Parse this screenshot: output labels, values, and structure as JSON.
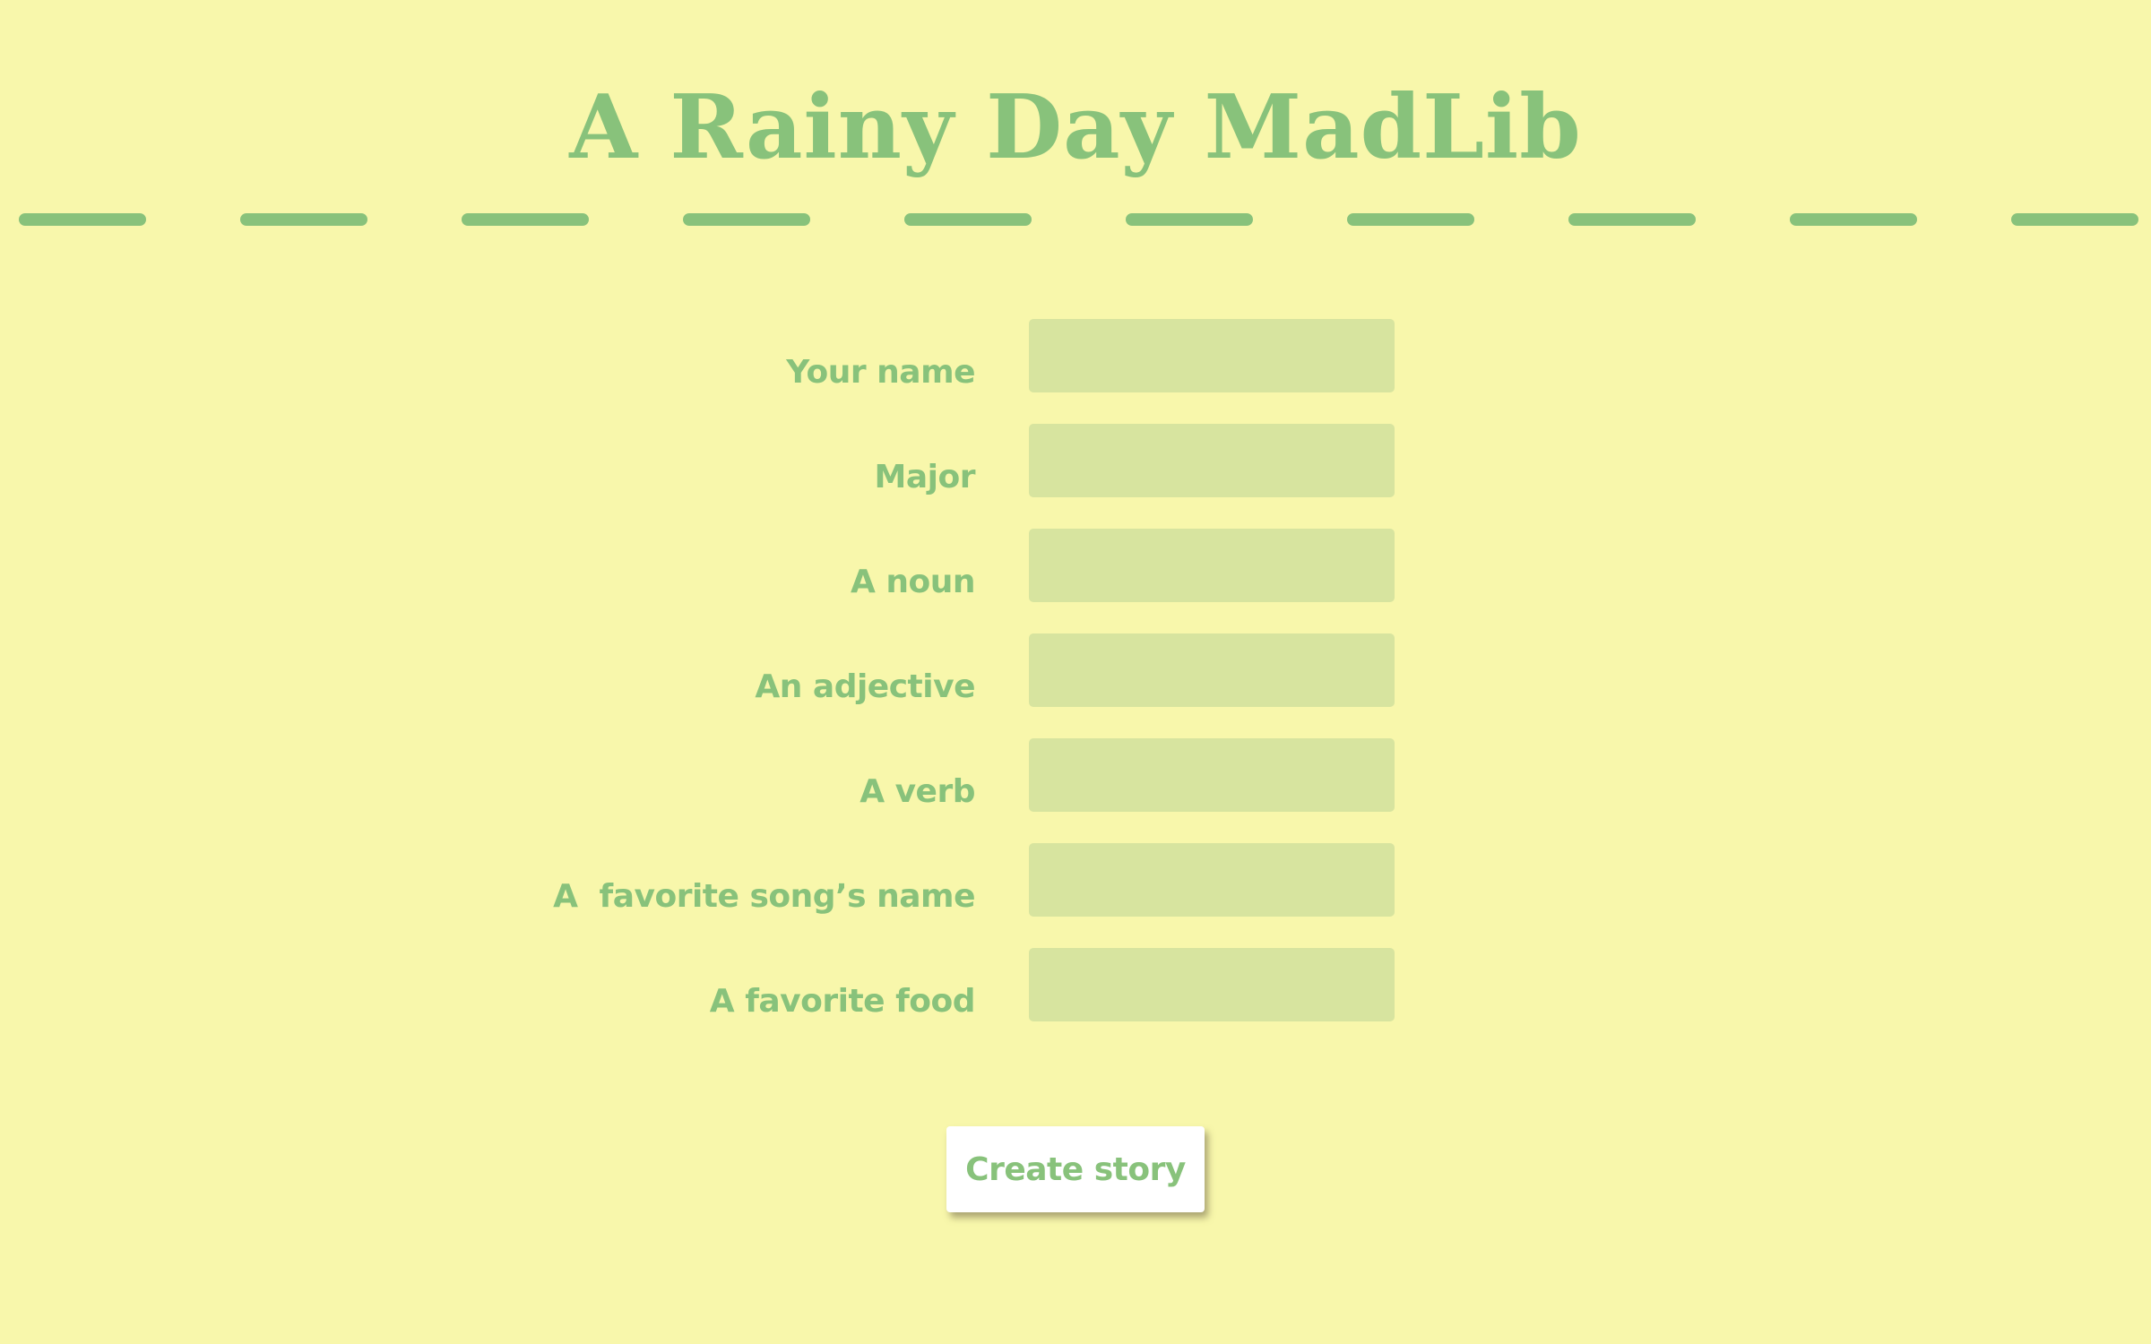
{
  "page": {
    "title": "A Rainy Day MadLib",
    "background_color": "#f8f7ab",
    "accent_color": "#88c27b",
    "input_color": "#d7e49f"
  },
  "form": {
    "fields": [
      {
        "label": "Your name",
        "value": "",
        "placeholder": ""
      },
      {
        "label": "Major",
        "value": "",
        "placeholder": ""
      },
      {
        "label": "A noun",
        "value": "",
        "placeholder": ""
      },
      {
        "label": "An adjective",
        "value": "",
        "placeholder": ""
      },
      {
        "label": "A verb",
        "value": "",
        "placeholder": ""
      },
      {
        "label": "A  favorite song’s name",
        "value": "",
        "placeholder": ""
      },
      {
        "label": "A favorite food",
        "value": "",
        "placeholder": ""
      }
    ],
    "submit_label": "Create story"
  }
}
